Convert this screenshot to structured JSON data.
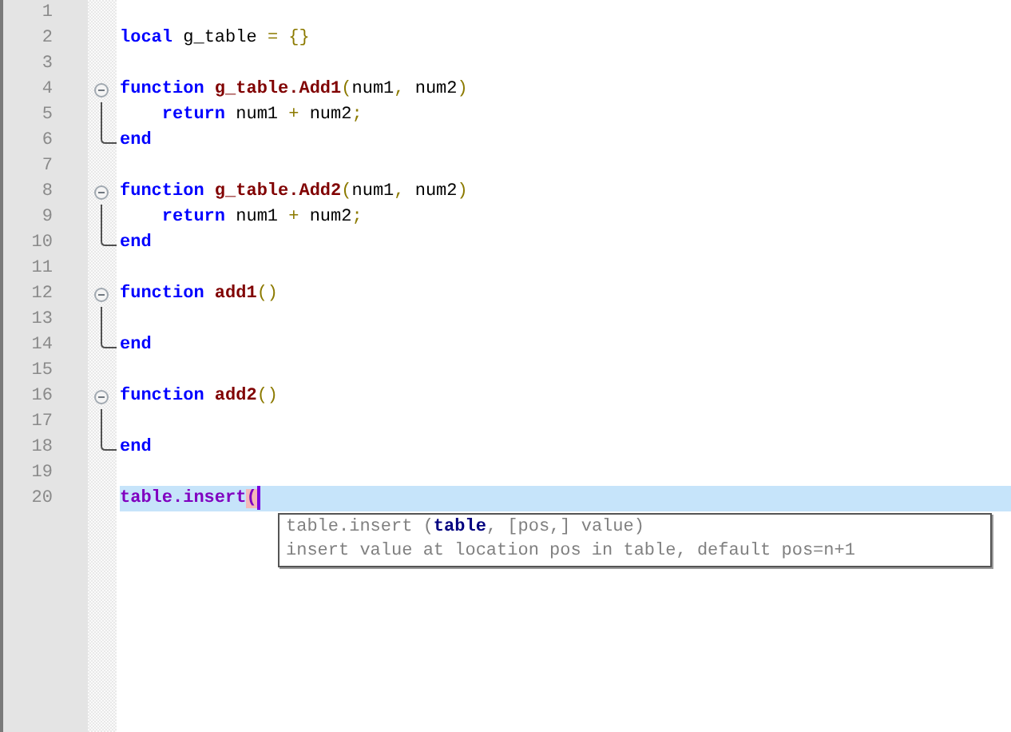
{
  "editor": {
    "lines": [
      {
        "number": "1"
      },
      {
        "number": "2",
        "tokens": [
          {
            "text": "local",
            "kind": "keyword"
          },
          {
            "text": " g_table ",
            "kind": "ident"
          },
          {
            "text": "= {}",
            "kind": "operator"
          }
        ]
      },
      {
        "number": "3"
      },
      {
        "number": "4",
        "kind": "start",
        "tokens": [
          {
            "text": "function ",
            "kind": "keyword"
          },
          {
            "text": "g_table.Add1",
            "kind": "funcname"
          },
          {
            "text": "(",
            "kind": "operator"
          },
          {
            "text": "num1",
            "kind": "ident"
          },
          {
            "text": ", ",
            "kind": "operator"
          },
          {
            "text": "num2",
            "kind": "ident"
          },
          {
            "text": ")",
            "kind": "operator"
          }
        ]
      },
      {
        "number": "5",
        "kind": "body",
        "tokens": [
          {
            "text": "    return",
            "kind": "keyword"
          },
          {
            "text": " num1 ",
            "kind": "ident"
          },
          {
            "text": "+",
            "kind": "operator"
          },
          {
            "text": " num2",
            "kind": "ident"
          },
          {
            "text": ";",
            "kind": "operator"
          }
        ]
      },
      {
        "number": "6",
        "kind": "end",
        "tokens": [
          {
            "text": "end",
            "kind": "keyword"
          }
        ]
      },
      {
        "number": "7"
      },
      {
        "number": "8",
        "kind": "start",
        "tokens": [
          {
            "text": "function ",
            "kind": "keyword"
          },
          {
            "text": "g_table.Add2",
            "kind": "funcname"
          },
          {
            "text": "(",
            "kind": "operator"
          },
          {
            "text": "num1",
            "kind": "ident"
          },
          {
            "text": ", ",
            "kind": "operator"
          },
          {
            "text": "num2",
            "kind": "ident"
          },
          {
            "text": ")",
            "kind": "operator"
          }
        ]
      },
      {
        "number": "9",
        "kind": "body",
        "tokens": [
          {
            "text": "    return",
            "kind": "keyword"
          },
          {
            "text": " num1 ",
            "kind": "ident"
          },
          {
            "text": "+",
            "kind": "operator"
          },
          {
            "text": " num2",
            "kind": "ident"
          },
          {
            "text": ";",
            "kind": "operator"
          }
        ]
      },
      {
        "number": "10",
        "kind": "end",
        "tokens": [
          {
            "text": "end",
            "kind": "keyword"
          }
        ]
      },
      {
        "number": "11"
      },
      {
        "number": "12",
        "kind": "start",
        "tokens": [
          {
            "text": "function ",
            "kind": "keyword"
          },
          {
            "text": "add1",
            "kind": "funcname"
          },
          {
            "text": "()",
            "kind": "operator"
          }
        ]
      },
      {
        "number": "13",
        "kind": "body"
      },
      {
        "number": "14",
        "kind": "end",
        "tokens": [
          {
            "text": "end",
            "kind": "keyword"
          }
        ]
      },
      {
        "number": "15"
      },
      {
        "number": "16",
        "kind": "start",
        "tokens": [
          {
            "text": "function ",
            "kind": "keyword"
          },
          {
            "text": "add2",
            "kind": "funcname"
          },
          {
            "text": "()",
            "kind": "operator"
          }
        ]
      },
      {
        "number": "17",
        "kind": "body"
      },
      {
        "number": "18",
        "kind": "end",
        "tokens": [
          {
            "text": "end",
            "kind": "keyword"
          }
        ]
      },
      {
        "number": "19"
      },
      {
        "number": "20",
        "current": true,
        "tokens": [
          {
            "text": "table.insert",
            "kind": "library"
          },
          {
            "text": "(",
            "kind": "brace-match"
          }
        ]
      }
    ],
    "calltip": {
      "signature": [
        {
          "text": "table.insert (",
          "current": false
        },
        {
          "text": "table",
          "current": true
        },
        {
          "text": ", [pos,] value)",
          "current": false
        }
      ],
      "description": "insert value at location pos in table, default pos=n+1"
    }
  }
}
